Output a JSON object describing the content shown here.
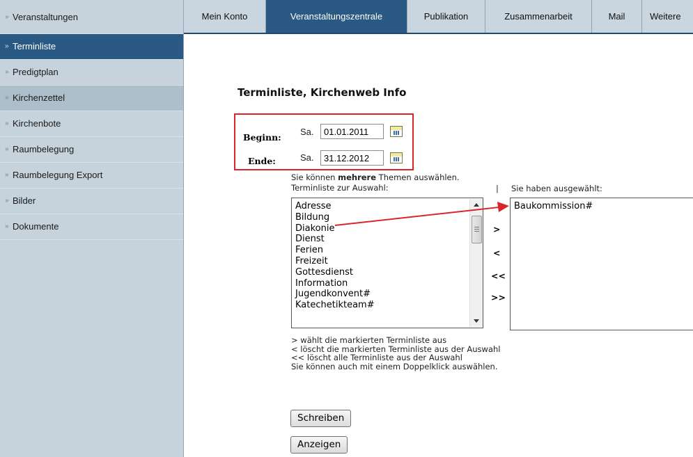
{
  "sidebar": {
    "header": "Veranstaltungen",
    "items": [
      {
        "label": "Terminliste"
      },
      {
        "label": "Predigtplan"
      },
      {
        "label": "Kirchenzettel"
      },
      {
        "label": "Kirchenbote"
      },
      {
        "label": "Raumbelegung"
      },
      {
        "label": "Raumbelegung Export"
      },
      {
        "label": "Bilder"
      },
      {
        "label": "Dokumente"
      }
    ],
    "bullet": "»"
  },
  "nav": {
    "tabs": [
      {
        "label": "Mein Konto"
      },
      {
        "label": "Veranstaltungszentrale"
      },
      {
        "label": "Publikation"
      },
      {
        "label": "Zusammenarbeit"
      },
      {
        "label": "Mail"
      },
      {
        "label": "Weitere"
      }
    ]
  },
  "main": {
    "title": "Terminliste, Kirchenweb Info",
    "begin": {
      "label": "Beginn:",
      "weekday": "Sa.",
      "value": "01.01.2011"
    },
    "end": {
      "label": "Ende:",
      "weekday": "Sa.",
      "value": "31.12.2012"
    },
    "hint_before": "Sie können ",
    "hint_bold": "mehrere",
    "hint_after": " Themen auswählen.",
    "available_label": "Terminliste zur Auswahl:",
    "separator": "|",
    "selected_label": "Sie haben ausgewählt:",
    "available_options": [
      "Adresse",
      "Bildung",
      "Diakonie",
      "Dienst",
      "Ferien",
      "Freizeit",
      "Gottesdienst",
      "Information",
      "Jugendkonvent#",
      "Katechetikteam#"
    ],
    "selected_options": [
      "Baukommission#"
    ],
    "move_buttons": {
      "add": ">",
      "remove": "<",
      "remove_all": "<<",
      "add_all": ">>"
    },
    "help": [
      "> wählt die markierten Terminliste aus",
      "< löscht die markierten Terminliste aus der Auswahl",
      "<< löscht alle Terminliste aus der Auswahl",
      "Sie können auch mit einem Doppelklick auswählen."
    ],
    "write_button": "Schreiben",
    "show_button": "Anzeigen"
  },
  "colors": {
    "accent": "#2a5a83",
    "annotation": "#d9262c",
    "sidebar_bg": "#c6d3dd"
  }
}
